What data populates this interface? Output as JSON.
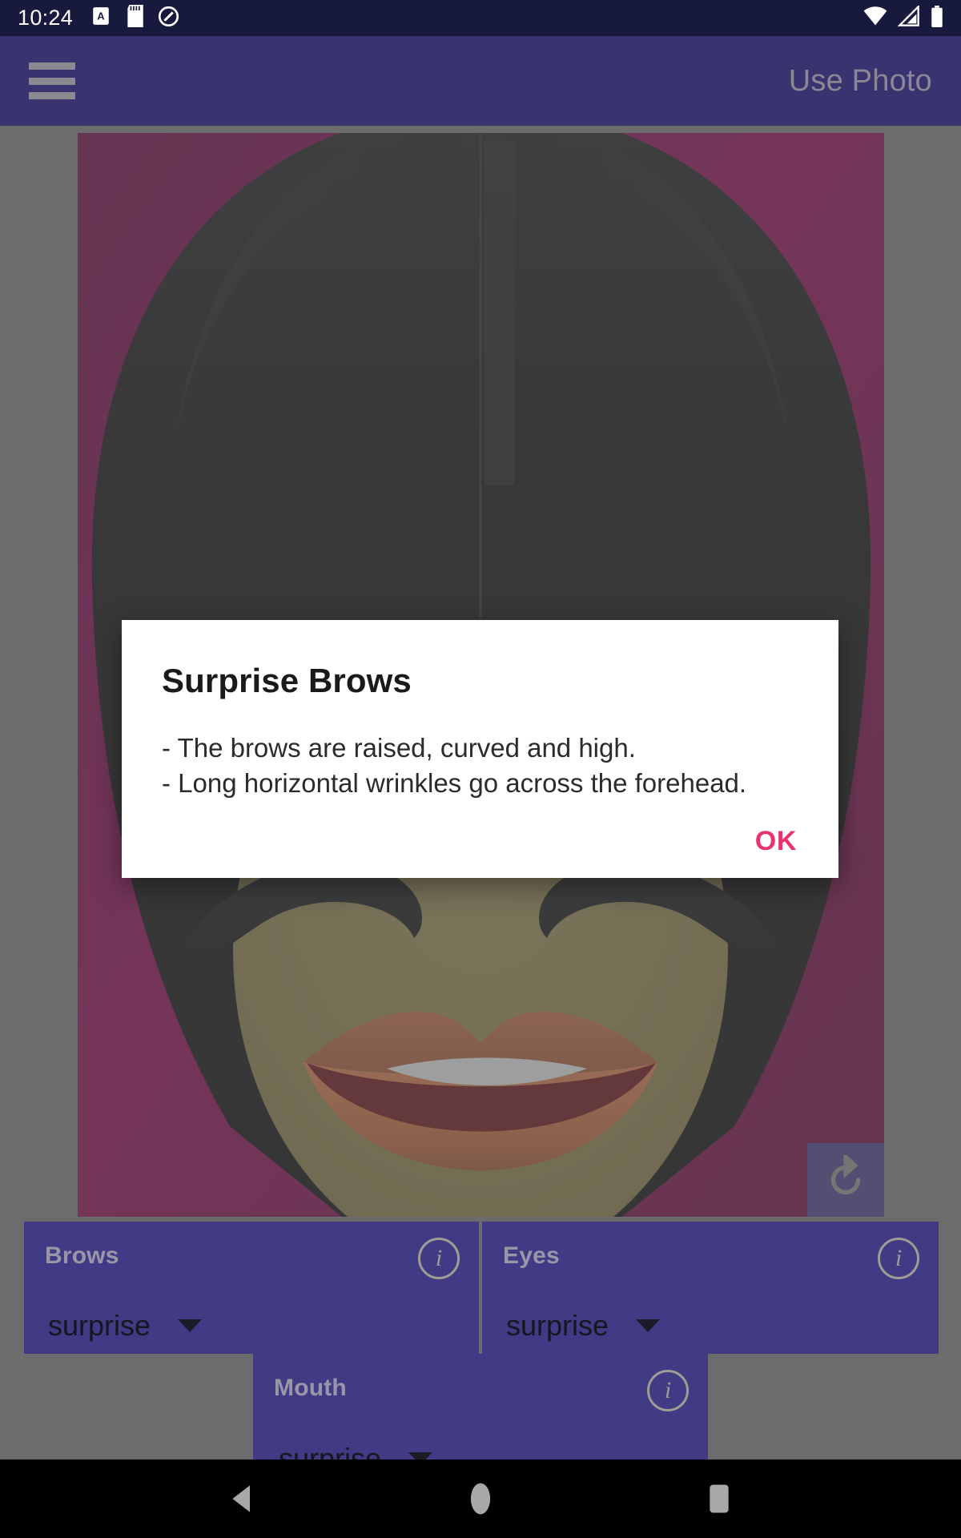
{
  "status_bar": {
    "time": "10:24",
    "left_icons": [
      "alarm-volume-icon",
      "sd-card-icon",
      "do-not-disturb-icon"
    ],
    "right_icons": [
      "wifi-icon",
      "cellular-signal-icon",
      "battery-icon"
    ]
  },
  "app_bar": {
    "menu_icon": "hamburger-menu-icon",
    "action_label": "Use Photo"
  },
  "photo": {
    "alt": "illustrated face with raised surprised brows and open smiling mouth",
    "background_color": "#6b0040",
    "skin_color": "#7c7040",
    "hair_color": "#0d0d0d",
    "lip_color": "#b5653c",
    "mouth_inner_color": "#5c0b0e",
    "teeth_color": "#c9c9c9",
    "rotate_icon": "refresh-rotate-icon"
  },
  "controls": {
    "panels": [
      {
        "title": "Brows",
        "value": "surprise",
        "info_icon": "info-icon",
        "caret_icon": "chevron-down-icon"
      },
      {
        "title": "Eyes",
        "value": "surprise",
        "info_icon": "info-icon",
        "caret_icon": "chevron-down-icon"
      },
      {
        "title": "Mouth",
        "value": "surprise",
        "info_icon": "info-icon",
        "caret_icon": "chevron-down-icon"
      }
    ]
  },
  "dialog": {
    "title": "Surprise Brows",
    "line1": "- The brows are raised, curved and high.",
    "line2": "- Long horizontal wrinkles go across the forehead.",
    "ok_label": "OK",
    "accent_color": "#e8336d"
  },
  "nav_bar": {
    "back_icon": "back-triangle-icon",
    "home_icon": "home-circle-icon",
    "recents_icon": "recents-square-icon"
  },
  "colors": {
    "app_bar": "#393370",
    "status_bar": "#171a3c",
    "panel": "#413a85",
    "scrim": "#6b6b6b"
  }
}
